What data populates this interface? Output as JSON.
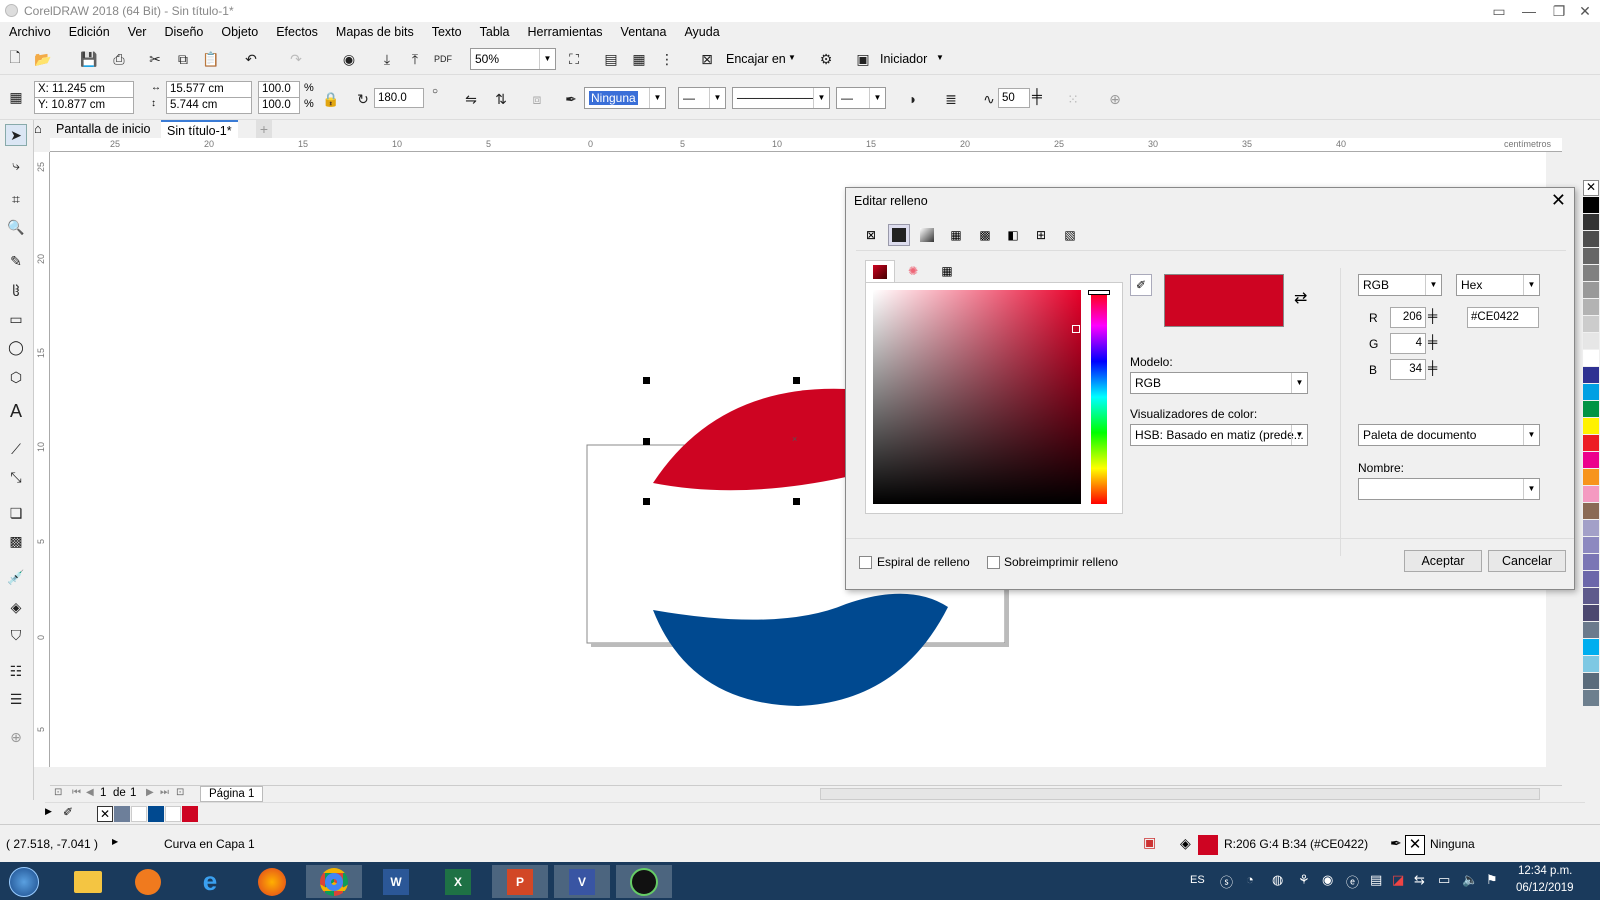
{
  "window": {
    "title": "CorelDRAW 2018 (64 Bit) - Sin título-1*"
  },
  "menu": [
    "Archivo",
    "Edición",
    "Ver",
    "Diseño",
    "Objeto",
    "Efectos",
    "Mapas de bits",
    "Texto",
    "Tabla",
    "Herramientas",
    "Ventana",
    "Ayuda"
  ],
  "toolbar": {
    "zoom": "50%",
    "snap_label": "Encajar en",
    "start_label": "Iniciador"
  },
  "propbar": {
    "x": "X: 11.245 cm",
    "y": "Y: 10.877 cm",
    "w": "15.577 cm",
    "h": "5.744 cm",
    "sx": "100.0",
    "sy": "100.0",
    "pct": "%",
    "angle": "180.0",
    "outline": "Ninguna",
    "smooth": "50"
  },
  "tabs": [
    "Pantalla de inicio",
    "Sin título-1*"
  ],
  "ruler": {
    "unit": "centímetros",
    "h_ticks": [
      "25",
      "20",
      "15",
      "10",
      "5",
      "0",
      "5",
      "10",
      "15",
      "20",
      "25",
      "30",
      "35",
      "40"
    ],
    "v_ticks": [
      "25",
      "20",
      "15",
      "10",
      "5",
      "0",
      "5"
    ]
  },
  "dialog": {
    "title": "Editar relleno",
    "model_label": "Modelo:",
    "model_value": "RGB",
    "viewers_label": "Visualizadores de color:",
    "viewers_value": "HSB: Basado en matiz (prede...",
    "colorspace": "RGB",
    "format": "Hex",
    "r_label": "R",
    "g_label": "G",
    "b_label": "B",
    "r": "206",
    "g": "4",
    "b": "34",
    "hex": "#CE0422",
    "palette_value": "Paleta de documento",
    "name_label": "Nombre:",
    "name_value": "",
    "spiral": "Espiral de relleno",
    "overprint": "Sobreimprimir relleno",
    "ok": "Aceptar",
    "cancel": "Cancelar",
    "color": "#CE0422"
  },
  "pagebar": {
    "page_num": "1",
    "of_label": "de",
    "page_total": "1",
    "page_tab": "Página 1"
  },
  "status": {
    "coords": "( 27.518, -7.041 )",
    "object": "Curva en Capa 1",
    "fill_info": "R:206 G:4 B:34 (#CE0422)",
    "outline_info": "Ninguna"
  },
  "taskbar": {
    "lang": "ES",
    "time": "12:34 p.m.",
    "date": "06/12/2019"
  },
  "colors": {
    "red": "#CE0422",
    "blue": "#004990"
  }
}
